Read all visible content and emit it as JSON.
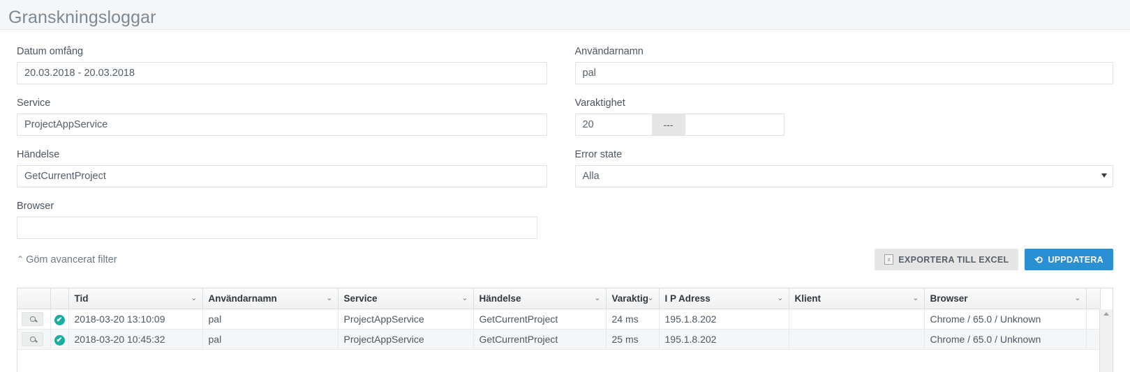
{
  "page": {
    "title": "Granskningsloggar"
  },
  "filters": {
    "date_range": {
      "label": "Datum omfång",
      "value": "20.03.2018 - 20.03.2018"
    },
    "username": {
      "label": "Användarnamn",
      "value": "pal"
    },
    "service": {
      "label": "Service",
      "value": "ProjectAppService"
    },
    "duration": {
      "label": "Varaktighet",
      "from": "20",
      "separator": "---",
      "to": ""
    },
    "event": {
      "label": "Händelse",
      "value": "GetCurrentProject"
    },
    "error_state": {
      "label": "Error state",
      "value": "Alla"
    },
    "browser": {
      "label": "Browser",
      "value": ""
    }
  },
  "toolbar": {
    "toggle_filter_label": "Göm avancerat filter",
    "toggle_chevron": "⌃",
    "export_label": "EXPORTERA TILL EXCEL",
    "export_icon_glyph": "x",
    "refresh_label": "UPPDATERA",
    "refresh_icon_glyph": "⟳",
    "primary_color": "#2b8fd4"
  },
  "table": {
    "headers": [
      {
        "key": "actions",
        "label": ""
      },
      {
        "key": "status",
        "label": ""
      },
      {
        "key": "tid",
        "label": "Tid"
      },
      {
        "key": "anvandarnamn",
        "label": "Användarnamn"
      },
      {
        "key": "service",
        "label": "Service"
      },
      {
        "key": "handelse",
        "label": "Händelse"
      },
      {
        "key": "varaktighet",
        "label": "Varaktig"
      },
      {
        "key": "ip",
        "label": "I P Adress"
      },
      {
        "key": "klient",
        "label": "Klient"
      },
      {
        "key": "browser",
        "label": "Browser"
      }
    ],
    "header_chevron": "⌄",
    "rows": [
      {
        "tid": "2018-03-20 13:10:09",
        "anvandarnamn": "pal",
        "service": "ProjectAppService",
        "handelse": "GetCurrentProject",
        "varaktighet": "24 ms",
        "ip": "195.1.8.202",
        "klient": "",
        "browser": "Chrome / 65.0 / Unknown",
        "status": "✔"
      },
      {
        "tid": "2018-03-20 10:45:32",
        "anvandarnamn": "pal",
        "service": "ProjectAppService",
        "handelse": "GetCurrentProject",
        "varaktighet": "25 ms",
        "ip": "195.1.8.202",
        "klient": "",
        "browser": "Chrome / 65.0 / Unknown",
        "status": "✔"
      }
    ]
  }
}
